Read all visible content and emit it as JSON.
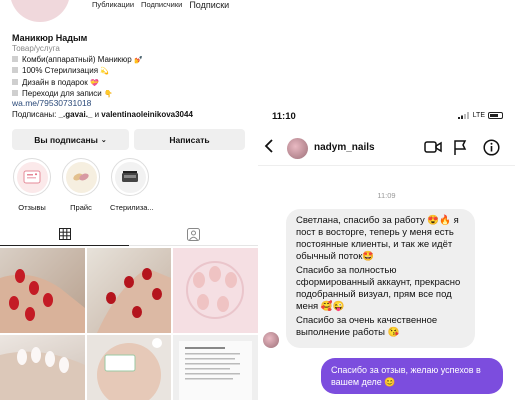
{
  "profile": {
    "top_tabs": [
      "Публикации",
      "Подписчики",
      "Подписки"
    ],
    "name": "Маникюр Надым",
    "category": "Товар/услуга",
    "bio": [
      {
        "text": "Комби(аппаратный) Маникюр",
        "emoji": "💅"
      },
      {
        "text": "100% Стерилизация",
        "emoji": "💫"
      },
      {
        "text": "Дизайн в подарок",
        "emoji": "💝"
      },
      {
        "text": "Переходи для записи",
        "emoji": "👇"
      }
    ],
    "link": "wa.me/79530731018",
    "followed_by_prefix": "Подписаны: ",
    "followed_by_user1": "_.gavai._",
    "followed_by_mid": " и ",
    "followed_by_user2": "valentinaoleinikova3044",
    "subscribed_label": "Вы подписаны",
    "subscribed_chevron": "⌄",
    "message_label": "Написать",
    "highlights": [
      {
        "label": "Отзывы",
        "icon": "review-card-icon"
      },
      {
        "label": "Прайс",
        "icon": "price-nails-icon"
      },
      {
        "label": "Стерилиза...",
        "icon": "sterilizer-icon"
      }
    ]
  },
  "chat": {
    "time": "11:10",
    "network": "LTE",
    "username": "nadym_nails",
    "day_separator": "11:09",
    "incoming": [
      "Светлана, спасибо за работу 😍🔥 я пост в восторге, теперь у меня есть постоянные клиенты, и так же идёт обычный поток🤩",
      "Спасибо за полностью сформированный аккаунт, прекрасно подобранный визуал, прям все под меня 🥰😜",
      "Спасибо за очень качественное выполнение работы 😘"
    ],
    "outgoing": "Спасибо за отзыв, желаю успехов в вашем деле 😊"
  },
  "colors": {
    "outgoing_bubble": "#7c4dde",
    "incoming_bubble": "#efefef",
    "link": "#2b4a7a"
  }
}
